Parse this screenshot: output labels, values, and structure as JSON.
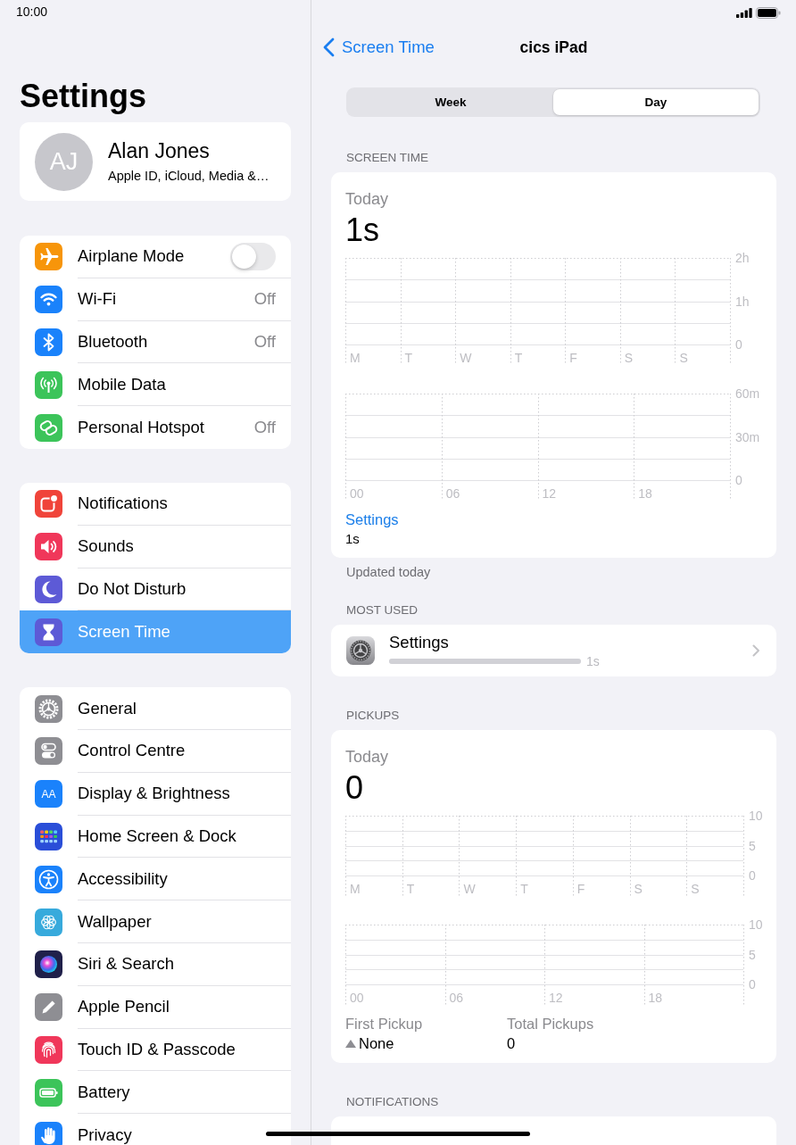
{
  "status_bar": {
    "time": "10:00"
  },
  "sidebar": {
    "title": "Settings",
    "profile": {
      "initials": "AJ",
      "name": "Alan Jones",
      "subtitle": "Apple ID, iCloud, Media &…"
    },
    "groups": [
      {
        "items": [
          {
            "label": "Airplane Mode",
            "kind": "toggle",
            "on": false,
            "selected": false,
            "color": "#f7950a"
          },
          {
            "label": "Wi-Fi",
            "kind": "nav",
            "value": "Off",
            "selected": false,
            "color": "#1a82fb"
          },
          {
            "label": "Bluetooth",
            "kind": "nav",
            "value": "Off",
            "selected": false,
            "color": "#1a82fb"
          },
          {
            "label": "Mobile Data",
            "kind": "nav",
            "selected": false,
            "color": "#3cc45a"
          },
          {
            "label": "Personal Hotspot",
            "kind": "nav",
            "value": "Off",
            "selected": false,
            "color": "#3cc45a"
          }
        ]
      },
      {
        "items": [
          {
            "label": "Notifications",
            "selected": false,
            "color": "#f0443a"
          },
          {
            "label": "Sounds",
            "selected": false,
            "color": "#f0375a"
          },
          {
            "label": "Do Not Disturb",
            "selected": false,
            "color": "#5d5ad6"
          },
          {
            "label": "Screen Time",
            "selected": true,
            "color": "#5d5ad6"
          }
        ]
      },
      {
        "items": [
          {
            "label": "General",
            "selected": false,
            "color": "#8e8e93"
          },
          {
            "label": "Control Centre",
            "selected": false,
            "color": "#8e8e93"
          },
          {
            "label": "Display & Brightness",
            "selected": false,
            "color": "#1a82fb",
            "icon_text": "AA"
          },
          {
            "label": "Home Screen & Dock",
            "selected": false,
            "color": "#2a4ed8"
          },
          {
            "label": "Accessibility",
            "selected": false,
            "color": "#1a82fb"
          },
          {
            "label": "Wallpaper",
            "selected": false,
            "color": "#37aadc"
          },
          {
            "label": "Siri & Search",
            "selected": false,
            "color": "#20204a"
          },
          {
            "label": "Apple Pencil",
            "selected": false,
            "color": "#8e8e93"
          },
          {
            "label": "Touch ID & Passcode",
            "selected": false,
            "color": "#f0375a"
          },
          {
            "label": "Battery",
            "selected": false,
            "color": "#3cc45a"
          },
          {
            "label": "Privacy",
            "selected": false,
            "color": "#1a82fb"
          }
        ]
      }
    ]
  },
  "detail": {
    "back": "Screen Time",
    "title": "cics iPad",
    "segments": [
      {
        "label": "Week",
        "selected": false
      },
      {
        "label": "Day",
        "selected": true
      }
    ],
    "sections": [
      {
        "kind": "usage",
        "header": "SCREEN TIME",
        "period": "Today",
        "total": "1s",
        "charts": [
          {
            "chart_data": {
              "type": "bar",
              "categories": [
                "M",
                "T",
                "W",
                "T",
                "F",
                "S",
                "S"
              ],
              "values": [
                0,
                0,
                0,
                0,
                0,
                0,
                0
              ],
              "ylim": [
                0,
                2
              ],
              "yticks": [
                {
                  "value": 0,
                  "label": "0"
                },
                {
                  "value": 1,
                  "label": "1h"
                },
                {
                  "value": 2,
                  "label": "2h"
                }
              ]
            }
          },
          {
            "chart_data": {
              "type": "bar",
              "categories": [
                "00",
                null,
                null,
                null,
                null,
                null,
                "06",
                null,
                null,
                null,
                null,
                null,
                "12",
                null,
                null,
                null,
                null,
                null,
                "18",
                null,
                null,
                null,
                null,
                null
              ],
              "values": [
                0,
                0,
                0,
                0,
                0,
                0,
                0,
                0,
                0,
                0,
                0,
                0,
                0,
                0,
                0,
                0,
                0,
                0,
                0,
                0,
                0,
                0,
                0,
                0
              ],
              "ylim": [
                0,
                60
              ],
              "yticks": [
                {
                  "value": 0,
                  "label": "0"
                },
                {
                  "value": 30,
                  "label": "30m"
                },
                {
                  "value": 60,
                  "label": "60m"
                }
              ]
            }
          }
        ],
        "categories": [
          {
            "name": "Settings",
            "time": "1s",
            "color": "#1a7ee9"
          }
        ],
        "footer": "Updated today"
      },
      {
        "kind": "apps",
        "header": "MOST USED",
        "apps": [
          {
            "name": "Settings",
            "time": "1s",
            "level": 1
          }
        ]
      },
      {
        "kind": "pickups",
        "header": "PICKUPS",
        "period": "Today",
        "total": "0",
        "charts": [
          {
            "chart_data": {
              "type": "bar",
              "categories": [
                "M",
                "T",
                "W",
                "T",
                "F",
                "S",
                "S"
              ],
              "values": [
                0,
                0,
                0,
                0,
                0,
                0,
                0
              ],
              "ylim": [
                0,
                10
              ],
              "yticks": [
                0,
                5,
                10
              ]
            }
          },
          {
            "chart_data": {
              "type": "bar",
              "categories": [
                "00",
                null,
                null,
                null,
                null,
                null,
                "06",
                null,
                null,
                null,
                null,
                null,
                "12",
                null,
                null,
                null,
                null,
                null,
                "18",
                null,
                null,
                null,
                null,
                null
              ],
              "values": [
                0,
                0,
                0,
                0,
                0,
                0,
                0,
                0,
                0,
                0,
                0,
                0,
                0,
                0,
                0,
                0,
                0,
                0,
                0,
                0,
                0,
                0,
                0,
                0
              ],
              "ylim": [
                0,
                10
              ],
              "yticks": [
                0,
                5,
                10
              ]
            }
          }
        ],
        "stats": [
          {
            "kind": "time",
            "label": "First Pickup",
            "value": "None"
          },
          {
            "kind": "count",
            "label": "Total Pickups",
            "value": "0"
          }
        ]
      },
      {
        "kind": "notifications",
        "header": "NOTIFICATIONS"
      }
    ]
  }
}
